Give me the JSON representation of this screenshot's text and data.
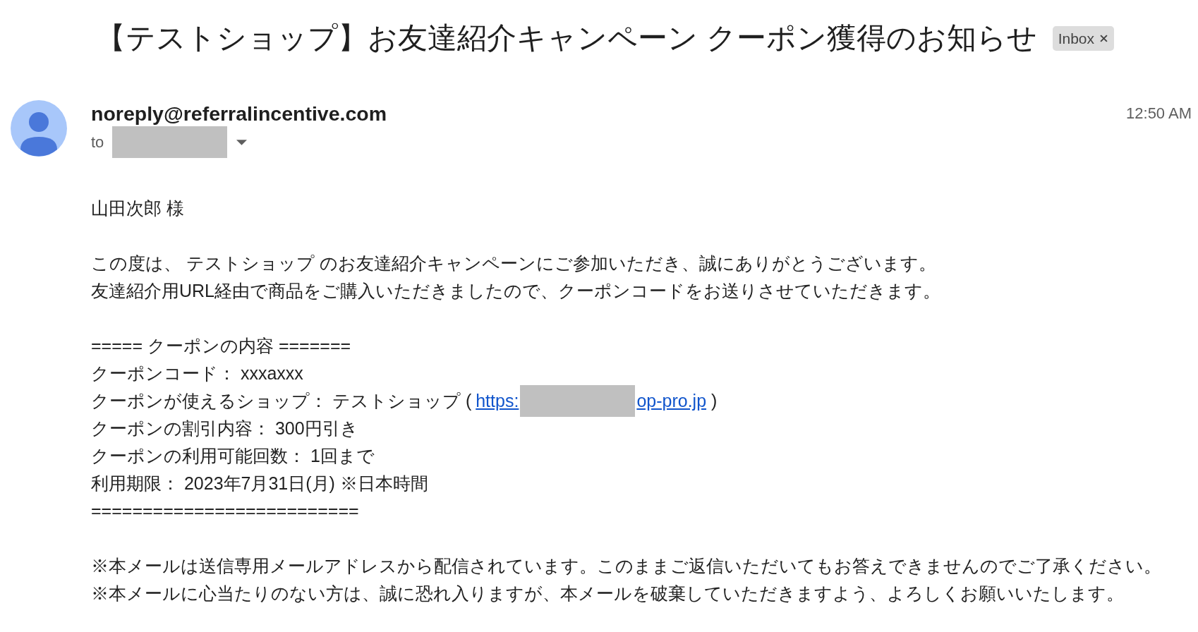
{
  "email": {
    "subject": "【テストショップ】お友達紹介キャンペーン クーポン獲得のお知らせ",
    "labels": [
      {
        "text": "Inbox",
        "removable": true
      }
    ],
    "sender": "noreply@referralincentive.com",
    "recipient_prefix": "to",
    "recipient_redacted": true,
    "time": "12:50 AM",
    "body": [
      {
        "lines": [
          {
            "kind": "text",
            "text": "山田次郎 様"
          }
        ]
      },
      {
        "lines": [
          {
            "kind": "text",
            "text": "この度は、 テストショップ のお友達紹介キャンペーンにご参加いただき、誠にありがとうございます。"
          },
          {
            "kind": "text",
            "text": "友達紹介用URL経由で商品をご購入いただきましたので、クーポンコードをお送りさせていただきます。"
          }
        ]
      },
      {
        "lines": [
          {
            "kind": "text",
            "text": "===== クーポンの内容 ======="
          },
          {
            "kind": "text",
            "text": "クーポンコード： xxxaxxx"
          },
          {
            "kind": "link",
            "text": "クーポンが使えるショップ： テストショップ (",
            "link_start": "https:",
            "redacted": true,
            "link_end": "op-pro.jp",
            "after": ")"
          },
          {
            "kind": "text",
            "text": "クーポンの割引内容： 300円引き"
          },
          {
            "kind": "text",
            "text": "クーポンの利用可能回数： 1回まで"
          },
          {
            "kind": "text",
            "text": "利用期限： 2023年7月31日(月) ※日本時間"
          },
          {
            "kind": "text",
            "text": "=========================="
          }
        ]
      },
      {
        "lines": [
          {
            "kind": "text",
            "text": "※本メールは送信専用メールアドレスから配信されています。このままご返信いただいてもお答えできませんのでご了承ください。"
          },
          {
            "kind": "text",
            "text": "※本メールに心当たりのない方は、誠に恐れ入りますが、本メールを破棄していただきますよう、よろしくお願いいたします。"
          }
        ]
      }
    ]
  }
}
